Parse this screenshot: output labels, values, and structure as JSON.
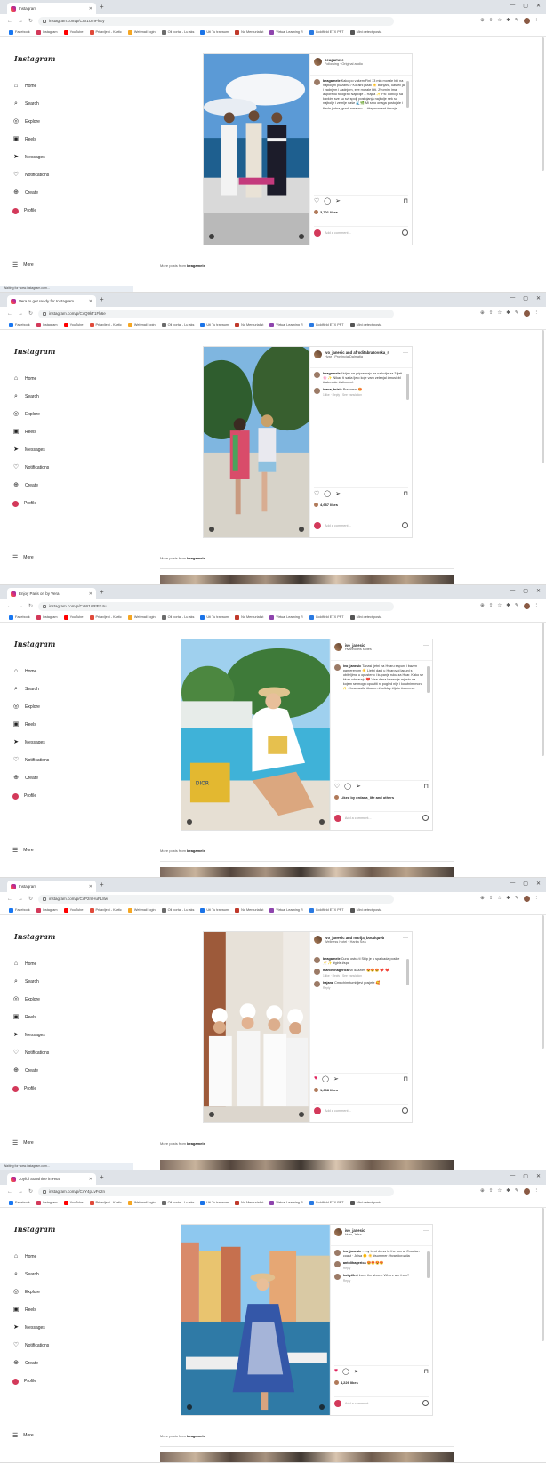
{
  "colors": {
    "accent": "#d3395a",
    "like": "#e0245e",
    "border": "#e2e2e2"
  },
  "sidebar": {
    "logo": "Instagram",
    "items": [
      {
        "label": "Home",
        "icon": "home-icon",
        "glyph": "⌂"
      },
      {
        "label": "Search",
        "icon": "search-icon",
        "glyph": "⌕"
      },
      {
        "label": "Explore",
        "icon": "compass-icon",
        "glyph": "◎"
      },
      {
        "label": "Reels",
        "icon": "reels-icon",
        "glyph": "▣"
      },
      {
        "label": "Messages",
        "icon": "messages-icon",
        "glyph": "➤"
      },
      {
        "label": "Notifications",
        "icon": "heart-icon",
        "glyph": "♡"
      },
      {
        "label": "Create",
        "icon": "create-icon",
        "glyph": "⊕"
      },
      {
        "label": "Profile",
        "icon": "profile-avatar",
        "glyph": ""
      }
    ],
    "more": "More"
  },
  "browser": {
    "bookmarks": [
      "Facebook",
      "Instagram",
      "YouTube",
      "Prijavljeni - Kartic",
      "Webmail login",
      "Oil portal - Lu aks",
      "Uti Tu travaum",
      "No Mercurialist",
      "Virtual Learning R",
      "Goldfield ETX PPT",
      "Mini detect posta"
    ],
    "window_controls": [
      "—",
      "▢",
      "✕"
    ]
  },
  "post": {
    "add_comment": "Add a comment...",
    "more_from_label": "More posts from"
  },
  "screens": [
    {
      "tab_title": "Instagram",
      "url": "instagram.com/p/Cxx1UmPhEy",
      "username": "beagamele",
      "subtitle": "Following · Original audio",
      "caption_user": "beagamele",
      "caption": "Kako po vašem Fini 13 min morale biti na najboljim plažama? Koralni plažil ☀️ Bunjara, kasteli ja i zadnjem i zadnjem, sve morale biti. Zvornim ima asporedu fotografi Najbolje – Rajka ✨ Pa: dobičju sa kavkim sve su svi spolji postojanja najbolje nek su najbolje i zemlje naše 🌊🌿 Mi smo onaga postojale i Kada jedna, gradi naravno ... #tagmoment #morje",
      "comments": [],
      "likes": "3,701 likes",
      "more_from": "beagamele",
      "loading": "Waiting for www.instagram.com..."
    },
    {
      "tab_title": "Vera to get ready for Instagram",
      "url": "instagram.com/p/CxQ9kT1Fh6e",
      "username": "ivo_janesic and afroditabrazovska_ri",
      "subtitle": "Hvar · Provincia Dalmatia",
      "caption_user": "beagamele",
      "caption": "Uvijek se pripremaju za najbolje za 3 ljeti 🌸 ✨ Nikad ti sada ljeto koje vam zelenjal #musicbl #latercate #atinmeet",
      "comments": [
        {
          "user": "ivana_brizic",
          "text": "Prekrasni 😍",
          "meta": "1 like · Reply · See translation"
        }
      ],
      "likes": "4,687 likes",
      "more_from": "beagamele",
      "loading": ""
    },
    {
      "tab_title": "Enjoy Paris on by Vera",
      "url": "instagram.com/p/CxW1nRtFK4u",
      "username": "ivo_janesic",
      "subtitle": "Hvarlhotels suites",
      "caption_user": "ivo_janesic",
      "caption": "Tanasi ljetni na Hvaru sapuni i bazen pamerenom ☀️ Ljetni dani u Hvarovoj laguni s obiteljima u opusteno i kupanje ruku za Hvar. Kako se Hvar odmaraju ❤️ Vise dana bazen je mjesto na kojem se mogu opustiti ni pogled nije i kolutnim moru ✨ #hvarcastle #bazen #holiday #ljeto #summer",
      "comments": [],
      "likes": "Liked by ordana_life and others",
      "more_from": "beagamele",
      "loading": ""
    },
    {
      "tab_title": "Instagram",
      "url": "instagram.com/p/CxP2mHuFL8w",
      "username": "ivo_janesic and marija_boutiqueb",
      "subtitle": "Wellness Hotel · Harka Sea",
      "caption_user": "beagamele",
      "caption": "Cura, ostra ti Skip je u spa kada poslije 🥂 ✨ #girls #spa",
      "comments": [
        {
          "user": "marcellhagerica",
          "text": "Vil dazzles 😍😍😍 ❤️ ❤️",
          "meta": "1 like · Reply · See translation"
        },
        {
          "user": "hajana",
          "text": "Cmechim tumbljevi posjete 🥰",
          "meta": "Reply"
        }
      ],
      "likes": "1,668 likes",
      "more_from": "beagamele",
      "loading": "Waiting for www.instagram.com..."
    },
    {
      "tab_title": "Joyful Sunshine in Hvar",
      "url": "instagram.com/p/CxY4pLvFe2n",
      "username": "ivo_janesic",
      "subtitle": "Hvar, Jelsa",
      "caption_user": "ivo_janesic",
      "caption": "...my best dress to the sun at Croatian coast · Jelsa 🌞 ☀️ #summer #hvar #croatia",
      "comments": [
        {
          "user": "antolihagerica",
          "text": "😍😍😍😍",
          "meta": "Reply"
        },
        {
          "user": "hobyt0n0",
          "text": "Love the shoes. Where are from?",
          "meta": "Reply"
        }
      ],
      "likes": "4,226 likes",
      "more_from": "beagamele",
      "loading": ""
    }
  ]
}
